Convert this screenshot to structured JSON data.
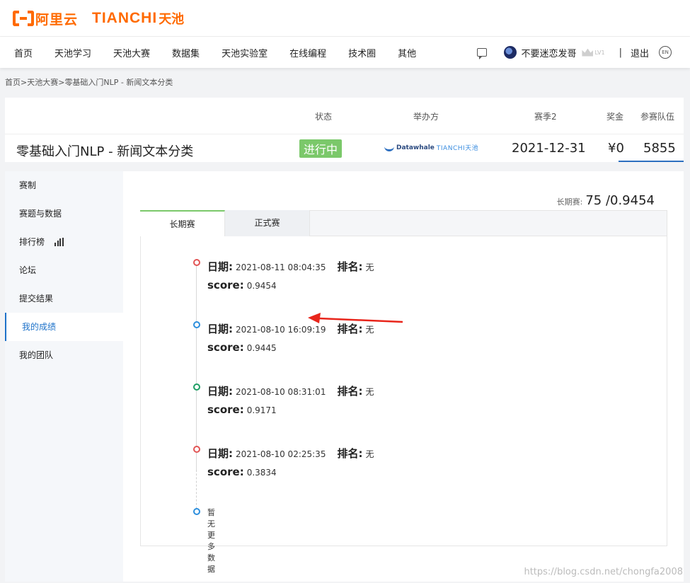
{
  "header": {
    "logo_aliyun": "阿里云",
    "logo_tianchi": "TIANCHI",
    "logo_tianchi_cn": "天池"
  },
  "nav": {
    "items": [
      "首页",
      "天池学习",
      "天池大赛",
      "数据集",
      "天池实验室",
      "在线编程",
      "技术圈",
      "其他"
    ],
    "user_name": "不要迷恋发哥",
    "level": "LV1",
    "separator": "|",
    "logout": "退出",
    "lang": "EN"
  },
  "breadcrumb": {
    "home": "首页",
    "sep": ">",
    "contest": "天池大赛",
    "current": "零基础入门NLP - 新闻文本分类"
  },
  "competition": {
    "headers": {
      "status": "状态",
      "organizer": "举办方",
      "season": "赛季2",
      "prize": "奖金",
      "teams": "参赛队伍"
    },
    "title": "零基础入门NLP - 新闻文本分类",
    "status": "进行中",
    "organizer_dw": "Datawhale",
    "organizer_tc": "TIANCHI天池",
    "season_date": "2021-12-31",
    "prize": "¥0",
    "teams": "5855"
  },
  "sidebar": {
    "items": [
      "赛制",
      "赛题与数据",
      "排行榜",
      "论坛",
      "提交结果",
      "我的成绩",
      "我的团队"
    ],
    "active": "我的成绩"
  },
  "content": {
    "long_score_label": "长期赛:",
    "long_score_value": "75 /0.9454",
    "tabs": [
      "长期赛",
      "正式赛"
    ],
    "date_label": "日期:",
    "rank_label": "排名:",
    "score_label": "score:",
    "records": [
      {
        "date": "2021-08-11 08:04:35",
        "rank": "无",
        "score": "0.9454",
        "dot_color": "#e25555"
      },
      {
        "date": "2021-08-10 16:09:19",
        "rank": "无",
        "score": "0.9445",
        "dot_color": "#2d8fdd"
      },
      {
        "date": "2021-08-10 08:31:01",
        "rank": "无",
        "score": "0.9171",
        "dot_color": "#1e9e64"
      },
      {
        "date": "2021-08-10 02:25:35",
        "rank": "无",
        "score": "0.3834",
        "dot_color": "#e25555"
      }
    ],
    "no_more": "暂无更多数据",
    "no_more_dot_color": "#2d8fdd",
    "arrow_color": "#e8251b"
  },
  "watermark": "https://blog.csdn.net/chongfa2008"
}
